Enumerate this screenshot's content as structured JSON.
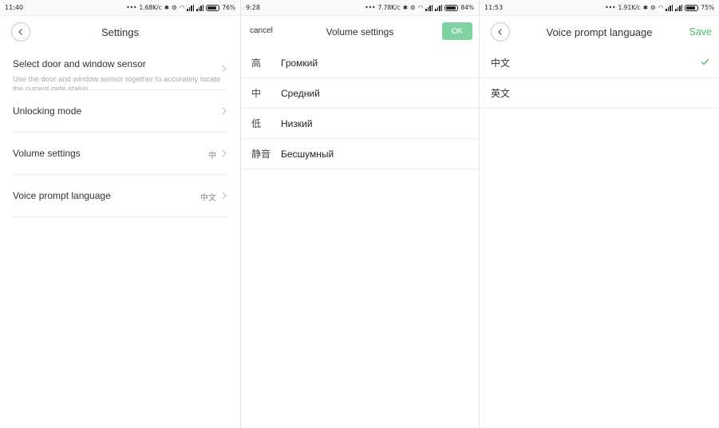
{
  "colors": {
    "accent_green": "#4cbb6e",
    "ok_button_bg": "#7fd3a2",
    "divider": "#ededed",
    "text": "#333333"
  },
  "panel1": {
    "status": {
      "time": "11:40",
      "dots": "•••",
      "speed": "1.68K/c",
      "battery": "76%",
      "battery_level": 0.76
    },
    "title": "Settings",
    "rows": [
      {
        "label": "Select door and window sensor",
        "desc": "Use the door and window sensor together to accurately locate the current gate status"
      },
      {
        "label": "Unlocking mode"
      },
      {
        "label": "Volume settings",
        "value": "中"
      },
      {
        "label": "Voice prompt language",
        "value": "中文"
      }
    ]
  },
  "panel2": {
    "status": {
      "time": "9:28",
      "dots": "•••",
      "speed": "7.78K/c",
      "battery": "84%",
      "battery_level": 0.84
    },
    "cancel": "cancel",
    "title": "Volume settings",
    "ok": "OK",
    "options": [
      {
        "code": "高",
        "label": "Громкий"
      },
      {
        "code": "中",
        "label": "Средний"
      },
      {
        "code": "低",
        "label": "Низкий"
      },
      {
        "code": "静音",
        "label": "Бесшумный"
      }
    ]
  },
  "panel3": {
    "status": {
      "time": "11:53",
      "dots": "•••",
      "speed": "1.91K/c",
      "battery": "75%",
      "battery_level": 0.75
    },
    "title": "Voice prompt language",
    "save": "Save",
    "options": [
      {
        "label": "中文",
        "selected": true
      },
      {
        "label": "英文",
        "selected": false
      }
    ]
  }
}
